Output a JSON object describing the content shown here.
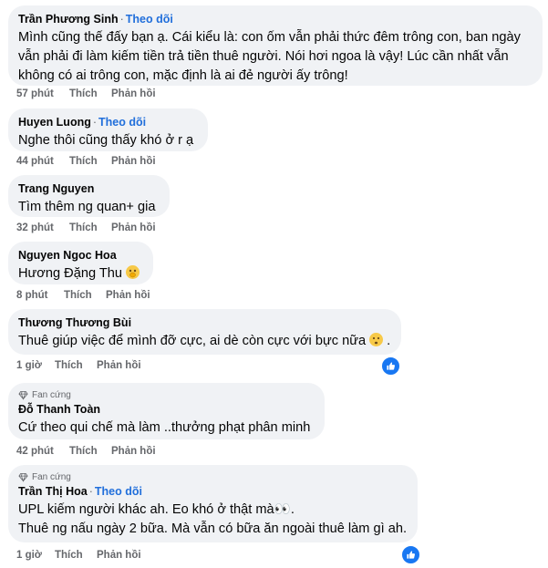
{
  "comments": [
    {
      "author": "Trần Phương Sinh",
      "follow": "Theo dõi",
      "lines": [
        "Mình cũng thế đấy bạn ạ. Cái kiểu là: con ốm vẫn phải thức đêm trông con, ban ngày",
        "vẫn phải đi làm kiếm tiền trả tiền thuê người. Nói hơi ngoa là vậy! Lúc cần nhất vẫn",
        "không có ai trông con, mặc định là ai đẻ người ấy trông!"
      ],
      "time": "57 phút",
      "like": "Thích",
      "reply": "Phản hồi"
    },
    {
      "author": "Huyen Luong",
      "follow": "Theo dõi",
      "lines": [
        "Nghe thôi cũng thấy khó ở r ạ"
      ],
      "time": "44 phút",
      "like": "Thích",
      "reply": "Phản hồi"
    },
    {
      "author": "Trang Nguyen",
      "lines": [
        "Tìm thêm ng quan+ gia"
      ],
      "time": "32 phút",
      "like": "Thích",
      "reply": "Phản hồi"
    },
    {
      "author": "Nguyen Ngoc Hoa",
      "lines": [
        "Hương Đặng Thu"
      ],
      "emoji": "face-with-hand-over-mouth",
      "time": "8 phút",
      "like": "Thích",
      "reply": "Phản hồi"
    },
    {
      "author": "Thương Thương Bùi",
      "lines": [
        "Thuê giúp việc để mình đỡ cực, ai dè còn cực với bực nữa"
      ],
      "line_suffix": ".",
      "emoji": "frowning-face",
      "time": "1 giờ",
      "like": "Thích",
      "reply": "Phản hồi",
      "reaction": "like"
    },
    {
      "badge": "Fan cứng",
      "author": "Đỗ Thanh Toàn",
      "lines": [
        "Cứ theo qui chế mà làm ..thưởng phạt phân minh"
      ],
      "time": "42 phút",
      "like": "Thích",
      "reply": "Phản hồi"
    },
    {
      "badge": "Fan cứng",
      "author": "Trần Thị Hoa",
      "follow": "Theo dõi",
      "lines": [
        "UPL kiếm người khác ah. Eo khó ở thật mà👀.",
        "Thuê ng nấu ngày 2 bữa. Mà vẫn có bữa ăn ngoài thuê làm gì ah."
      ],
      "time": "1 giờ",
      "like": "Thích",
      "reply": "Phản hồi",
      "reaction": "like"
    }
  ],
  "colors": {
    "bubble": "#f0f2f5",
    "link": "#216fdb",
    "muted": "#65676b",
    "like_blue": "#1877f2"
  }
}
